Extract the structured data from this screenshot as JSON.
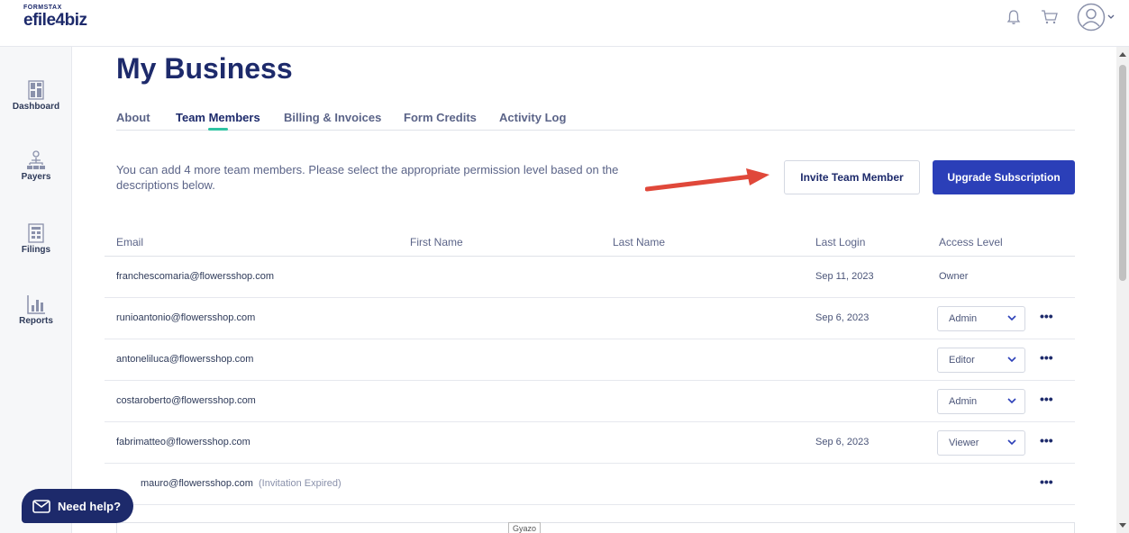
{
  "brand": {
    "top": "FORMSTAX",
    "name": "efile4biz"
  },
  "sidebar": {
    "items": [
      {
        "label": "Dashboard",
        "icon": "dashboard-icon"
      },
      {
        "label": "Payers",
        "icon": "payers-icon"
      },
      {
        "label": "Filings",
        "icon": "filings-icon"
      },
      {
        "label": "Reports",
        "icon": "reports-icon"
      }
    ]
  },
  "page": {
    "title": "My Business"
  },
  "tabs": [
    {
      "label": "About"
    },
    {
      "label": "Team Members",
      "active": true
    },
    {
      "label": "Billing & Invoices"
    },
    {
      "label": "Form Credits"
    },
    {
      "label": "Activity Log"
    }
  ],
  "team": {
    "description": "You can add 4 more team members. Please select the appropriate permission level based on the descriptions below.",
    "invite_label": "Invite Team Member",
    "upgrade_label": "Upgrade Subscription"
  },
  "table": {
    "columns": [
      "Email",
      "First Name",
      "Last Name",
      "Last Login",
      "Access Level"
    ],
    "rows": [
      {
        "email": "franchescomaria@flowersshop.com",
        "last_login": "Sep 11, 2023",
        "access": "Owner"
      },
      {
        "email": "runioantonio@flowersshop.com",
        "last_login": "Sep 6, 2023",
        "access": "Admin"
      },
      {
        "email": "antoneliluca@flowersshop.com",
        "last_login": "",
        "access": "Editor"
      },
      {
        "email": "costaroberto@flowersshop.com",
        "last_login": "",
        "access": "Admin"
      },
      {
        "email": "fabrimatteo@flowersshop.com",
        "last_login": "Sep 6, 2023",
        "access": "Viewer"
      },
      {
        "email": "mauro@flowersshop.com",
        "status": "(Invitation Expired)"
      }
    ]
  },
  "help": {
    "label": "Need help?"
  },
  "watermark": "Gyazo",
  "colors": {
    "primary": "#2b3fb8",
    "navy": "#1d2a6b",
    "accent": "#2fc3a2",
    "arrow": "#e0483a"
  }
}
